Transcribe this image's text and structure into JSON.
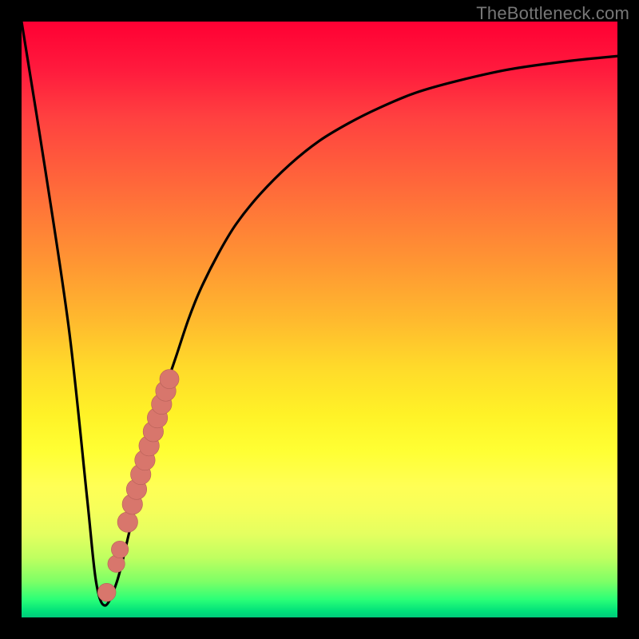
{
  "watermark": "TheBottleneck.com",
  "colors": {
    "background": "#000000",
    "curve": "#000000",
    "dots": "#d8766c",
    "dots_stroke": "#b76058"
  },
  "chart_data": {
    "type": "line",
    "title": "",
    "xlabel": "",
    "ylabel": "",
    "xlim": [
      0,
      100
    ],
    "ylim": [
      0,
      100
    ],
    "grid": false,
    "legend": false,
    "series": [
      {
        "name": "bottleneck-curve",
        "x": [
          0,
          4,
          8,
          11,
          12.5,
          14,
          16,
          18,
          20,
          22,
          24,
          26,
          28,
          30,
          33,
          36,
          40,
          45,
          50,
          55,
          60,
          66,
          73,
          82,
          92,
          100
        ],
        "values": [
          100,
          75,
          48,
          20,
          6,
          2,
          6,
          14,
          23,
          31,
          38,
          44,
          50,
          55,
          61,
          66,
          71,
          76,
          80,
          83,
          85.5,
          88,
          90,
          92,
          93.4,
          94.2
        ]
      }
    ],
    "dots": [
      {
        "x": 14.3,
        "y": 4.2,
        "r": 1.1
      },
      {
        "x": 15.9,
        "y": 9.0,
        "r": 1.0
      },
      {
        "x": 16.5,
        "y": 11.4,
        "r": 1.0
      },
      {
        "x": 17.8,
        "y": 16.0,
        "r": 1.3
      },
      {
        "x": 18.6,
        "y": 19.0,
        "r": 1.3
      },
      {
        "x": 19.3,
        "y": 21.5,
        "r": 1.3
      },
      {
        "x": 20.0,
        "y": 24.0,
        "r": 1.3
      },
      {
        "x": 20.7,
        "y": 26.4,
        "r": 1.3
      },
      {
        "x": 21.4,
        "y": 28.8,
        "r": 1.3
      },
      {
        "x": 22.1,
        "y": 31.2,
        "r": 1.3
      },
      {
        "x": 22.8,
        "y": 33.5,
        "r": 1.3
      },
      {
        "x": 23.5,
        "y": 35.8,
        "r": 1.3
      },
      {
        "x": 24.2,
        "y": 38.0,
        "r": 1.3
      },
      {
        "x": 24.8,
        "y": 40.0,
        "r": 1.2
      }
    ]
  }
}
